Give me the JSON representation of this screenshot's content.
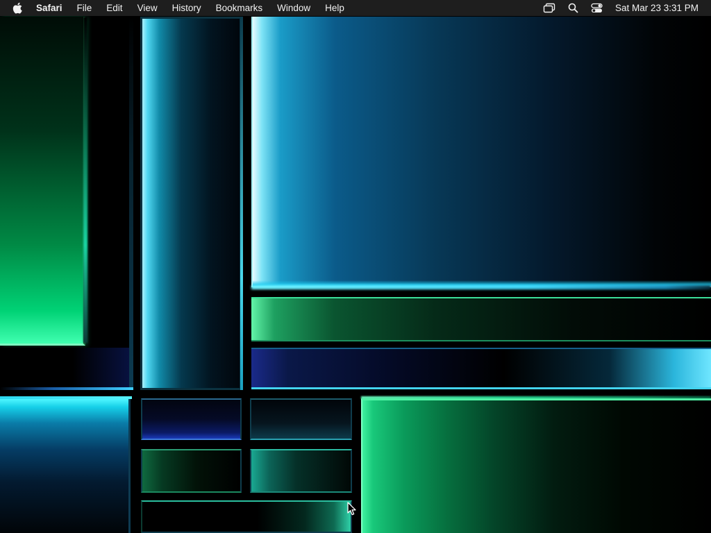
{
  "menubar": {
    "apple_icon": "apple-logo-icon",
    "app_name": "Safari",
    "items": [
      "File",
      "Edit",
      "View",
      "History",
      "Bookmarks",
      "Window",
      "Help"
    ],
    "status_icons": [
      "screen-mirroring-icon",
      "search-icon",
      "control-center-icon"
    ],
    "clock": "Sat Mar 23  3:31 PM"
  },
  "desktop": {
    "wallpaper": "abstract-glowing-panels",
    "colors": {
      "menubar_bg": "#1e1e1e",
      "menubar_text": "#f2f2f2",
      "cyan_glow": "#4fd6f0",
      "green_glow": "#3ff0a0",
      "deep_blue": "#0b5b8a",
      "background": "#000000"
    }
  },
  "cursor": {
    "icon": "arrow-cursor-icon"
  }
}
